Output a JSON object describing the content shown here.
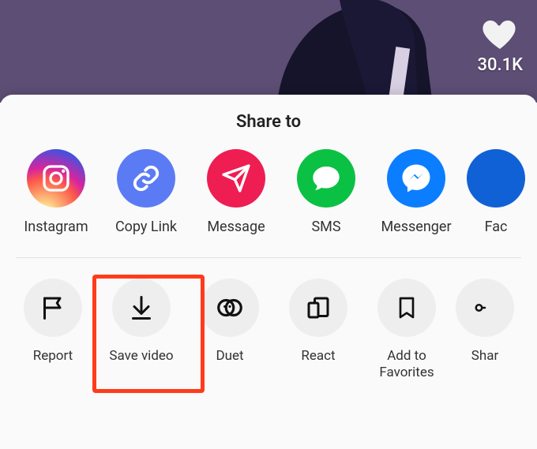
{
  "like_count": "30.1K",
  "sheet": {
    "title": "Share to",
    "share_items": [
      {
        "label": "Instagram"
      },
      {
        "label": "Copy Link"
      },
      {
        "label": "Message"
      },
      {
        "label": "SMS"
      },
      {
        "label": "Messenger"
      },
      {
        "label": "Fac"
      }
    ],
    "action_items": [
      {
        "label": "Report"
      },
      {
        "label": "Save video"
      },
      {
        "label": "Duet"
      },
      {
        "label": "React"
      },
      {
        "label": "Add to Favorites"
      },
      {
        "label": "Shar"
      }
    ]
  },
  "highlighted_action_index": 1
}
